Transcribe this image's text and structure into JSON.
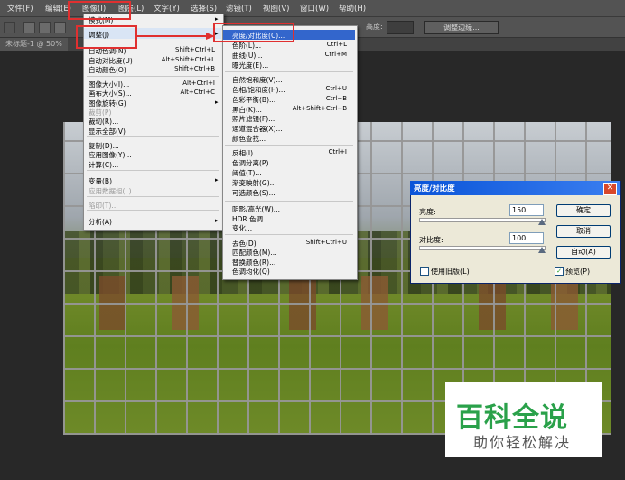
{
  "menubar": {
    "items": [
      "文件(F)",
      "编辑(E)",
      "图像(I)",
      "图层(L)",
      "文字(Y)",
      "选择(S)",
      "滤镜(T)",
      "视图(V)",
      "窗口(W)",
      "帮助(H)"
    ]
  },
  "optionsbar": {
    "height_label": "高度:",
    "refine_edge": "调整边缘..."
  },
  "document_tab": "未标题-1 @ 50%",
  "image_menu": {
    "items": [
      {
        "label": "模式(M)",
        "shortcut": "",
        "submenu": true
      },
      {
        "label": "调整(J)",
        "shortcut": "",
        "submenu": true
      },
      {
        "label": "自动色调(N)",
        "shortcut": "Shift+Ctrl+L"
      },
      {
        "label": "自动对比度(U)",
        "shortcut": "Alt+Shift+Ctrl+L"
      },
      {
        "label": "自动颜色(O)",
        "shortcut": "Shift+Ctrl+B"
      },
      {
        "label": "图像大小(I)...",
        "shortcut": "Alt+Ctrl+I"
      },
      {
        "label": "画布大小(S)...",
        "shortcut": "Alt+Ctrl+C"
      },
      {
        "label": "图像旋转(G)",
        "shortcut": "",
        "submenu": true
      },
      {
        "label": "裁剪(P)",
        "shortcut": "",
        "disabled": true
      },
      {
        "label": "裁切(R)...",
        "shortcut": ""
      },
      {
        "label": "显示全部(V)",
        "shortcut": ""
      },
      {
        "label": "复制(D)...",
        "shortcut": ""
      },
      {
        "label": "应用图像(Y)...",
        "shortcut": ""
      },
      {
        "label": "计算(C)...",
        "shortcut": ""
      },
      {
        "label": "变量(B)",
        "shortcut": "",
        "submenu": true
      },
      {
        "label": "应用数据组(L)...",
        "shortcut": "",
        "disabled": true
      },
      {
        "label": "陷印(T)...",
        "shortcut": "",
        "disabled": true
      },
      {
        "label": "分析(A)",
        "shortcut": "",
        "submenu": true
      }
    ]
  },
  "adjust_menu": {
    "items": [
      {
        "label": "亮度/对比度(C)...",
        "shortcut": ""
      },
      {
        "label": "色阶(L)...",
        "shortcut": "Ctrl+L"
      },
      {
        "label": "曲线(U)...",
        "shortcut": "Ctrl+M"
      },
      {
        "label": "曝光度(E)...",
        "shortcut": ""
      },
      {
        "label": "自然饱和度(V)...",
        "shortcut": ""
      },
      {
        "label": "色相/饱和度(H)...",
        "shortcut": "Ctrl+U"
      },
      {
        "label": "色彩平衡(B)...",
        "shortcut": "Ctrl+B"
      },
      {
        "label": "黑白(K)...",
        "shortcut": "Alt+Shift+Ctrl+B"
      },
      {
        "label": "照片滤镜(F)...",
        "shortcut": ""
      },
      {
        "label": "通道混合器(X)...",
        "shortcut": ""
      },
      {
        "label": "颜色查找...",
        "shortcut": ""
      },
      {
        "label": "反相(I)",
        "shortcut": "Ctrl+I"
      },
      {
        "label": "色调分离(P)...",
        "shortcut": ""
      },
      {
        "label": "阈值(T)...",
        "shortcut": ""
      },
      {
        "label": "渐变映射(G)...",
        "shortcut": ""
      },
      {
        "label": "可选颜色(S)...",
        "shortcut": ""
      },
      {
        "label": "阴影/高光(W)...",
        "shortcut": ""
      },
      {
        "label": "HDR 色调...",
        "shortcut": ""
      },
      {
        "label": "变化...",
        "shortcut": ""
      },
      {
        "label": "去色(D)",
        "shortcut": "Shift+Ctrl+U"
      },
      {
        "label": "匹配颜色(M)...",
        "shortcut": ""
      },
      {
        "label": "替换颜色(R)...",
        "shortcut": ""
      },
      {
        "label": "色调均化(Q)",
        "shortcut": ""
      }
    ]
  },
  "dialog": {
    "title": "亮度/对比度",
    "brightness_label": "亮度:",
    "brightness_value": "150",
    "contrast_label": "对比度:",
    "contrast_value": "100",
    "ok": "确定",
    "cancel": "取消",
    "auto": "自动(A)",
    "use_legacy": "使用旧版(L)",
    "preview": "预览(P)",
    "close_glyph": "✕",
    "check_glyph": "✓"
  },
  "watermark": {
    "main": "百科全说",
    "sub": "助你轻松解决"
  },
  "colors": {
    "accent_red": "#e03030",
    "menu_highlight": "#3366cc",
    "watermark_green": "#2aa14a"
  }
}
